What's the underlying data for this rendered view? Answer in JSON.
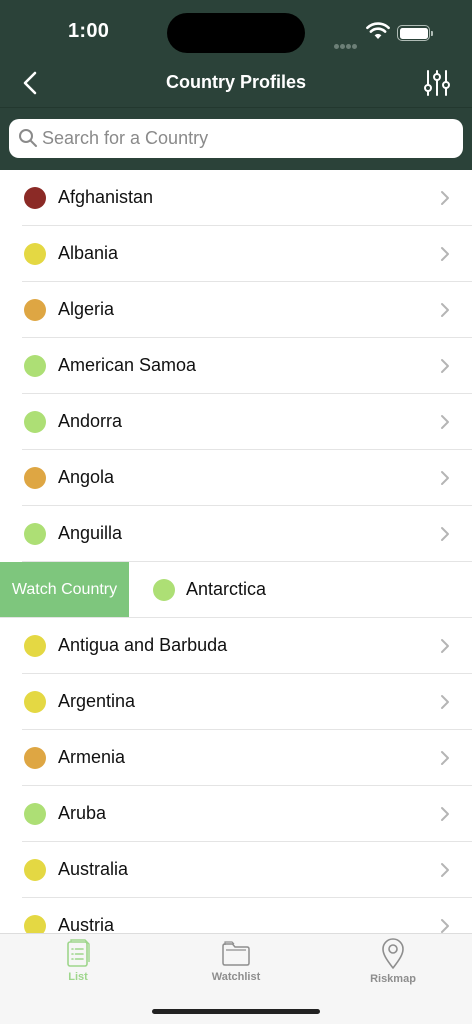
{
  "status_bar": {
    "time": "1:00"
  },
  "nav": {
    "title": "Country Profiles"
  },
  "search": {
    "placeholder": "Search for a Country",
    "value": ""
  },
  "countries": [
    {
      "name": "Afghanistan",
      "risk_color": "#8b2a26"
    },
    {
      "name": "Albania",
      "risk_color": "#e4d843"
    },
    {
      "name": "Algeria",
      "risk_color": "#dea643"
    },
    {
      "name": "American Samoa",
      "risk_color": "#addf75"
    },
    {
      "name": "Andorra",
      "risk_color": "#addf75"
    },
    {
      "name": "Angola",
      "risk_color": "#dea643"
    },
    {
      "name": "Anguilla",
      "risk_color": "#addf75"
    },
    {
      "name": "Antarctica",
      "risk_color": "#addf75",
      "swipe_action": "Watch Country"
    },
    {
      "name": "Antigua and Barbuda",
      "risk_color": "#e4d843"
    },
    {
      "name": "Argentina",
      "risk_color": "#e4d843"
    },
    {
      "name": "Armenia",
      "risk_color": "#dea643"
    },
    {
      "name": "Aruba",
      "risk_color": "#addf75"
    },
    {
      "name": "Australia",
      "risk_color": "#e4d843"
    },
    {
      "name": "Austria",
      "risk_color": "#e4d843"
    }
  ],
  "tabbar": {
    "tabs": [
      {
        "label": "List",
        "icon": "list-document-icon",
        "active": true
      },
      {
        "label": "Watchlist",
        "icon": "folder-icon",
        "active": false
      },
      {
        "label": "Riskmap",
        "icon": "map-pin-icon",
        "active": false
      }
    ]
  },
  "colors": {
    "header_bg": "#2b4239",
    "accent_green": "#7ec67d",
    "active_tab": "#9ed68c"
  }
}
